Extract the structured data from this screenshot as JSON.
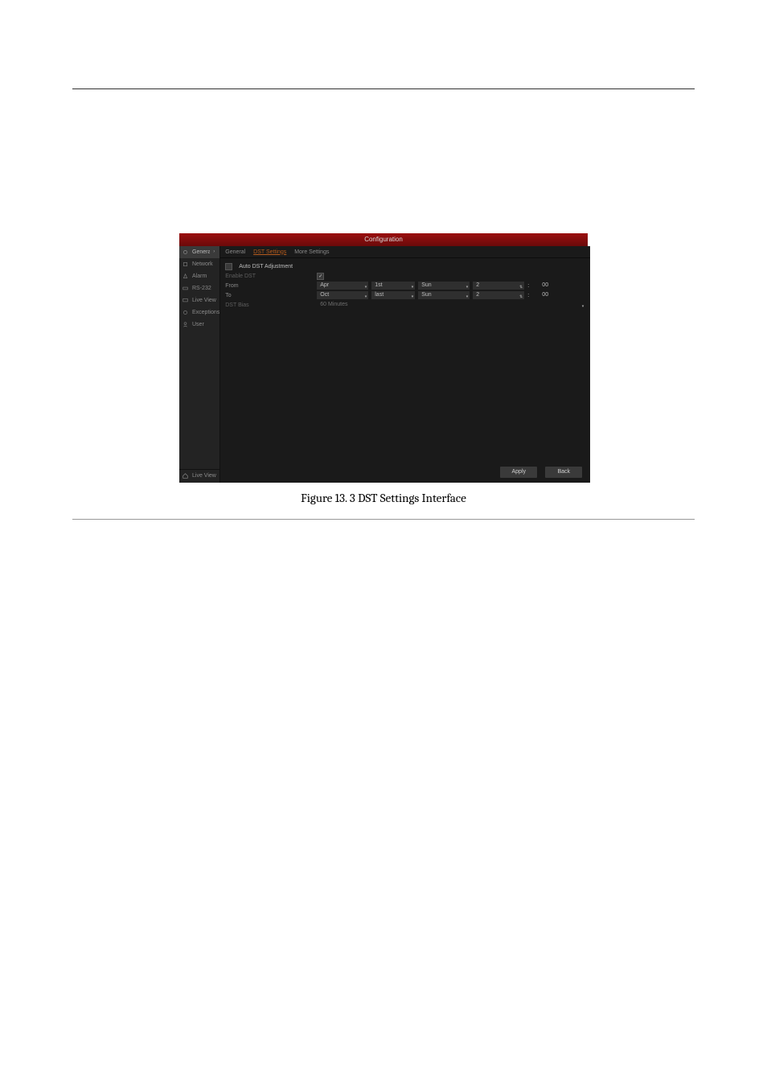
{
  "caption": "Figure 13. 3 DST Settings Interface",
  "app": {
    "title": "Configuration",
    "sidebar": {
      "items": [
        {
          "label": "General",
          "selected": true
        },
        {
          "label": "Network",
          "selected": false
        },
        {
          "label": "Alarm",
          "selected": false
        },
        {
          "label": "RS-232",
          "selected": false
        },
        {
          "label": "Live View",
          "selected": false
        },
        {
          "label": "Exceptions",
          "selected": false
        },
        {
          "label": "User",
          "selected": false
        }
      ],
      "live_view": "Live View"
    },
    "tabs": [
      {
        "label": "General",
        "active": false
      },
      {
        "label": "DST Settings",
        "active": true
      },
      {
        "label": "More Settings",
        "active": false
      }
    ],
    "form": {
      "auto_dst": {
        "label": "Auto DST Adjustment",
        "checked": false
      },
      "enable_dst": {
        "label": "Enable DST",
        "checked": true
      },
      "from": {
        "label": "From",
        "month": "Apr",
        "ordinal": "1st",
        "day": "Sun",
        "hour": "2",
        "minute": "00"
      },
      "to": {
        "label": "To",
        "month": "Oct",
        "ordinal": "last",
        "day": "Sun",
        "hour": "2",
        "minute": "00"
      },
      "dst_bias": {
        "label": "DST Bias",
        "value": "60 Minutes"
      }
    },
    "buttons": {
      "apply": "Apply",
      "back": "Back"
    }
  }
}
